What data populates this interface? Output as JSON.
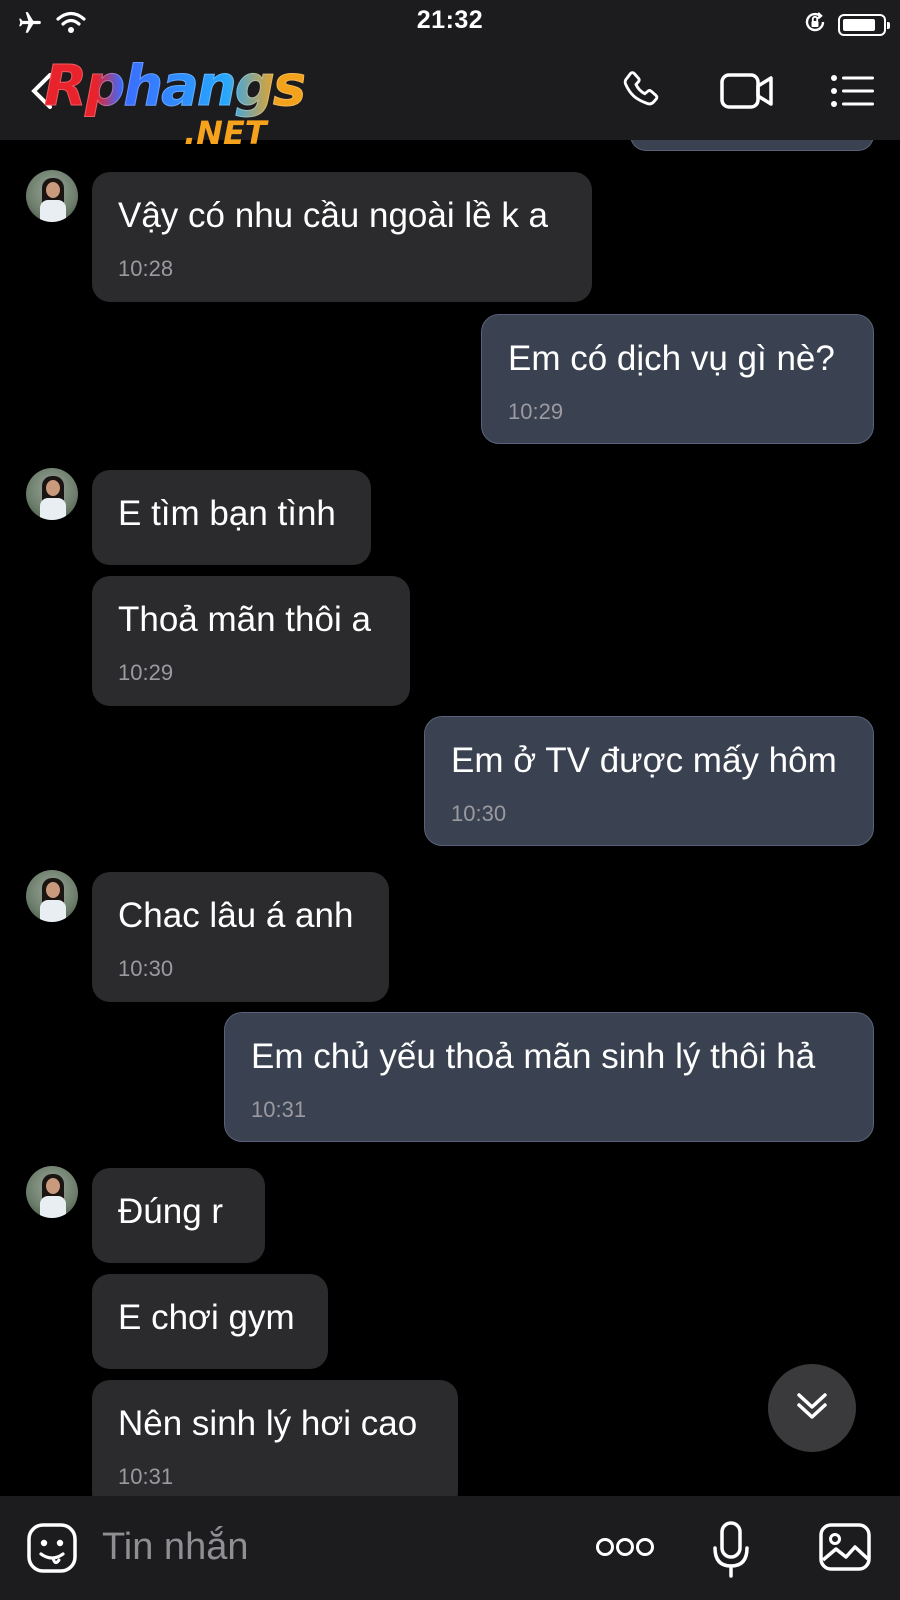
{
  "status_bar": {
    "time": "21:32"
  },
  "header": {
    "logo_main": "Rphangs",
    "logo_sub": ".NET"
  },
  "messages": [
    {
      "side": "in",
      "text": "Vậy có nhu cầu ngoài lề k a",
      "time": "10:28"
    },
    {
      "side": "out",
      "text": "Em có dịch vụ gì nè?",
      "time": "10:29"
    },
    {
      "side": "in",
      "text": "E tìm bạn tình",
      "time": ""
    },
    {
      "side": "in",
      "text": "Thoả mãn thôi a",
      "time": "10:29"
    },
    {
      "side": "out",
      "text": "Em ở TV được mấy hôm",
      "time": "10:30"
    },
    {
      "side": "in",
      "text": "Chac lâu á anh",
      "time": "10:30"
    },
    {
      "side": "out",
      "text": "Em chủ yếu thoả mãn sinh lý thôi hả",
      "time": "10:31"
    },
    {
      "side": "in",
      "text": " Đúng r",
      "time": ""
    },
    {
      "side": "in",
      "text": "E chơi gym",
      "time": ""
    },
    {
      "side": "in",
      "text": "Nên sinh lý hơi cao",
      "time": "10:31"
    }
  ],
  "composer": {
    "placeholder": "Tin nhắn"
  },
  "icons": {
    "status_left": [
      "airplane-icon",
      "wifi-icon"
    ],
    "status_right": [
      "rotation-lock-icon",
      "battery-icon"
    ],
    "header": [
      "phone-icon",
      "video-camera-icon",
      "list-menu-icon"
    ],
    "composer": [
      "emoji-icon",
      "more-icon",
      "microphone-icon",
      "image-icon"
    ],
    "scroll_down": "double-chevron-down-icon"
  },
  "colors": {
    "incoming_bubble": "#2b2b2d",
    "outgoing_bubble": "#3a4150",
    "background": "#000000"
  },
  "battery_level": 0.85
}
